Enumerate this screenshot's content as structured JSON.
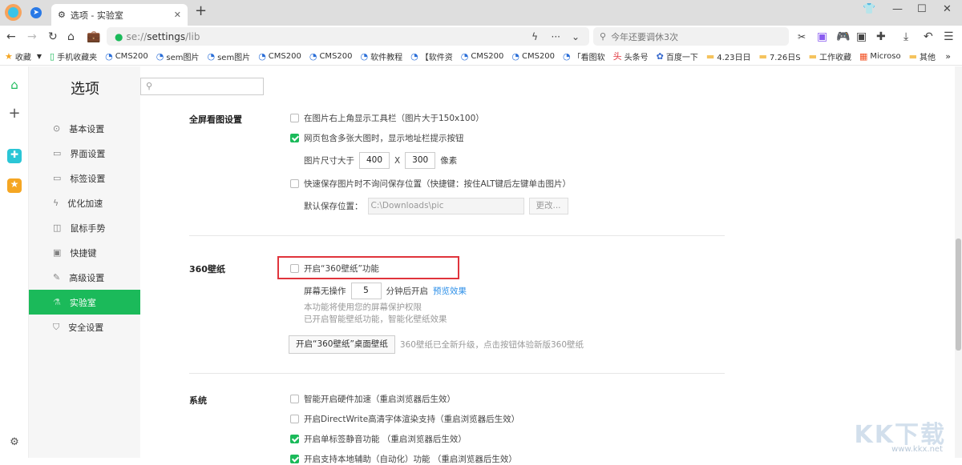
{
  "tab": {
    "title": "选项 - 实验室"
  },
  "address": {
    "scheme": "se://",
    "host": "settings",
    "path": "/lib"
  },
  "search": {
    "placeholder": "今年还要调休3次"
  },
  "bookmarks": [
    {
      "label": "收藏",
      "icon": "star-icon"
    },
    {
      "label": "手机收藏夹",
      "icon": "phone-icon"
    },
    {
      "label": "CMS200",
      "icon": "site-icon"
    },
    {
      "label": "sem图片",
      "icon": "site-icon"
    },
    {
      "label": "sem图片",
      "icon": "site-icon"
    },
    {
      "label": "CMS200",
      "icon": "site-icon"
    },
    {
      "label": "CMS200",
      "icon": "site-icon"
    },
    {
      "label": "软件教程",
      "icon": "site-icon"
    },
    {
      "label": "【软件资",
      "icon": "site-icon"
    },
    {
      "label": "CMS200",
      "icon": "site-icon"
    },
    {
      "label": "CMS200",
      "icon": "site-icon"
    },
    {
      "label": "「看图软",
      "icon": "site-icon"
    },
    {
      "label": "头条号",
      "icon": "toutiao-icon"
    },
    {
      "label": "百度一下",
      "icon": "baidu-icon"
    },
    {
      "label": "4.23日日",
      "icon": "folder-icon"
    },
    {
      "label": "7.26日S",
      "icon": "folder-icon"
    },
    {
      "label": "工作收藏",
      "icon": "folder-icon"
    },
    {
      "label": "Microso",
      "icon": "microsoft-icon"
    },
    {
      "label": "其他",
      "icon": "folder-icon"
    }
  ],
  "settings": {
    "title": "选项",
    "menu": [
      {
        "label": "基本设置",
        "icon": "⊙"
      },
      {
        "label": "界面设置",
        "icon": "▭"
      },
      {
        "label": "标签设置",
        "icon": "▭"
      },
      {
        "label": "优化加速",
        "icon": "ϟ"
      },
      {
        "label": "鼠标手势",
        "icon": "◫"
      },
      {
        "label": "快捷键",
        "icon": "▣"
      },
      {
        "label": "高级设置",
        "icon": "✎"
      },
      {
        "label": "实验室",
        "icon": "⚗"
      },
      {
        "label": "安全设置",
        "icon": "⛉"
      }
    ],
    "active_index": 7
  },
  "fullscreen": {
    "heading": "全屏看图设置",
    "opt1": "在图片右上角显示工具栏（图片大于150x100）",
    "opt1_checked": false,
    "opt2": "网页包含多张大图时，显示地址栏提示按钮",
    "opt2_checked": true,
    "size_label": "图片尺寸大于",
    "width": "400",
    "x": "X",
    "height": "300",
    "unit": "像素",
    "opt3": "快速保存图片时不询问保存位置（快捷键：按住ALT键后左键单击图片）",
    "opt3_checked": false,
    "path_label": "默认保存位置：",
    "path": "C:\\Downloads\\pic",
    "change": "更改..."
  },
  "wallpaper": {
    "heading": "360壁纸",
    "opt": "开启“360壁纸”功能",
    "opt_checked": false,
    "idle_label": "屏幕无操作",
    "idle_value": "5",
    "idle_suffix": "分钟后开启",
    "preview": "预览效果",
    "note1": "本功能将使用您的屏幕保护权限",
    "note2": "已开启智能壁纸功能，智能化壁纸效果",
    "desktop_button": "开启“360壁纸”桌面壁纸",
    "desktop_note": "360壁纸已全新升级，点击按钮体验新版360壁纸"
  },
  "system": {
    "heading": "系统",
    "options": [
      {
        "label": "智能开启硬件加速（重启浏览器后生效）",
        "checked": false
      },
      {
        "label": "开启DirectWrite高清字体渲染支持（重启浏览器后生效）",
        "checked": false
      },
      {
        "label": "开启单标签静音功能 （重启浏览器后生效）",
        "checked": true
      },
      {
        "label": "开启支持本地辅助（自动化）功能 （重启浏览器后生效）",
        "checked": true
      }
    ]
  },
  "watermark": {
    "text": "KK下载",
    "url": "www.kkx.net"
  },
  "colors": {
    "accent": "#1bba5a",
    "highlight": "#e0343c",
    "link": "#2a8ee8"
  }
}
